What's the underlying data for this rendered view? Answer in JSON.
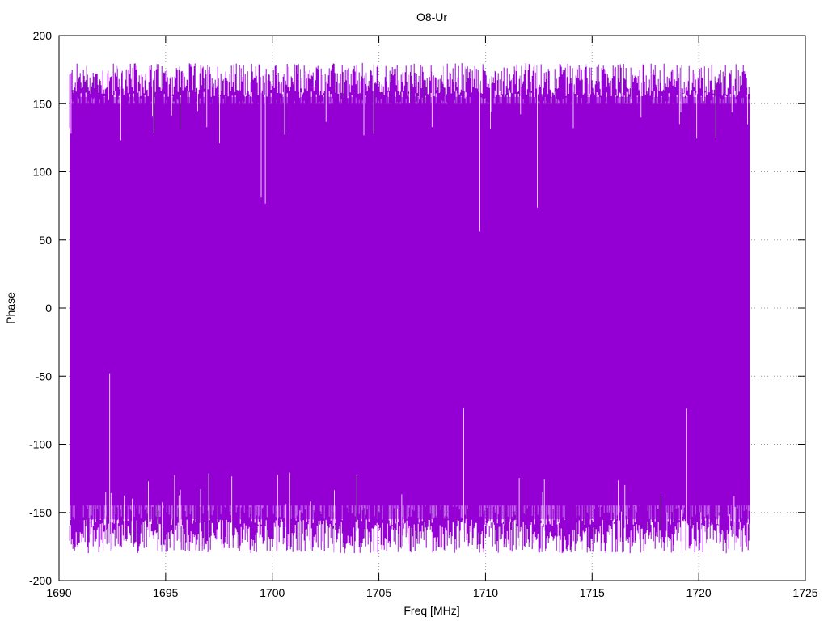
{
  "chart_data": {
    "type": "line",
    "title": "O8-Ur",
    "xlabel": "Freq [MHz]",
    "ylabel": "Phase",
    "xlim": [
      1690,
      1725
    ],
    "ylim": [
      -200,
      200
    ],
    "xticks": [
      1690,
      1695,
      1700,
      1705,
      1710,
      1715,
      1720,
      1725
    ],
    "yticks": [
      -200,
      -150,
      -100,
      -50,
      0,
      50,
      100,
      150,
      200
    ],
    "grid": true,
    "series": [
      {
        "color": "#9400d3",
        "x_range": [
          1690.5,
          1722.4
        ],
        "y_envelope": [
          -180,
          180
        ],
        "description_visible": "dense phase trace spanning nearly the full -180 to 180 range"
      }
    ]
  }
}
